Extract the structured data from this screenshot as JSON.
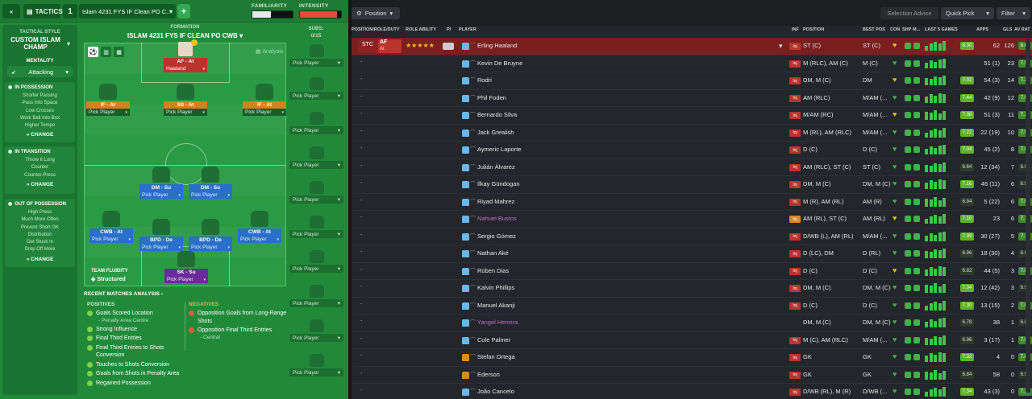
{
  "topbar": {
    "back_icon": "double-chevron-left-icon",
    "tactics_label": "TACTICS",
    "slot_number": "1",
    "tactic_name": "Islam 4231 FYS IF Clean  PO C...",
    "familiarity_label": "FAMILIARITY",
    "intensity_label": "INTENSITY",
    "familiarity_level": 0.45,
    "intensity_level": 0.9
  },
  "sidebar": {
    "style_label": "TACTICAL STYLE",
    "style_name": "CUSTOM ISLAM CHAMP",
    "mentality_label": "MENTALITY",
    "mentality_value": "Attacking",
    "in_possession": {
      "title": "IN POSSESSION",
      "lines": [
        "Shorter Passing",
        "Pass Into Space",
        "Low Crosses",
        "Work Ball Into Box",
        "Higher Tempo"
      ],
      "change": "CHANGE"
    },
    "in_transition": {
      "title": "IN TRANSITION",
      "lines": [
        "Throw It Long",
        "Counter",
        "Counter-Press"
      ],
      "change": "CHANGE"
    },
    "out_of_possession": {
      "title": "OUT OF POSSESSION",
      "lines": [
        "High Press",
        "Much More Often",
        "Prevent Short GK",
        "Distribution",
        "Get Stuck In",
        "Drop Off More"
      ],
      "change": "CHANGE"
    }
  },
  "formation": {
    "label": "FORMATION",
    "name": "ISLAM 4231 FYS IF CLEAN  PO CWB",
    "subs_label": "SUBS:",
    "subs_count": "0/15",
    "analysis_label": "Analysis",
    "fluidity_label": "TEAM FLUIDITY",
    "fluidity_value": "Structured",
    "pick": "Pick Player",
    "slots": {
      "af": {
        "role": "AF - At",
        "player": "Haaland"
      },
      "if_l": {
        "role": "IF - At"
      },
      "ss": {
        "role": "SS - At"
      },
      "if_r": {
        "role": "IF - At"
      },
      "dm_l": {
        "role": "DM - Su"
      },
      "dm_r": {
        "role": "DM - Su"
      },
      "cwb_l": {
        "role": "CWB - At"
      },
      "bpd_l": {
        "role": "BPD - De"
      },
      "bpd_r": {
        "role": "BPD - De"
      },
      "cwb_r": {
        "role": "CWB - At"
      },
      "sk": {
        "role": "SK - Su"
      }
    }
  },
  "analysis": {
    "title": "RECENT MATCHES ANALYSIS",
    "positives_label": "POSITIVES",
    "negatives_label": "NEGATIVES",
    "positives": [
      "Goals Scored Location",
      "Strong Influence",
      "Final Third Entries",
      "Final Third Entries to Shots Conversion",
      "Touches to Shots Conversion",
      "Goals from Shots in Penalty Area",
      "Regained Possession"
    ],
    "positive_sub": "- Penalty Area Centre",
    "negatives": [
      "Opposition Goals from Long-Range Shots",
      "Opposition Final Third Entries"
    ],
    "negative_sub": "- Central"
  },
  "toolbar": {
    "position_btn": "Position",
    "selection_advice": "Selection Advice",
    "quick_pick": "Quick Pick",
    "filter": "Filter"
  },
  "columns": [
    "POSITION/ROLE/DUTY",
    "ROLE ABILITY",
    "PI",
    "PLAYER",
    "INF",
    "POSITION",
    "BEST POS",
    "CON",
    "SHP",
    "M...",
    "LAST 5 GAMES",
    "APPS",
    "GLS",
    "AV RAT"
  ],
  "selected_row": {
    "slot": "STC",
    "role": "AF",
    "duty": "At",
    "stars": "★★★★★"
  },
  "players": [
    {
      "name": "Erling Haaland",
      "inf": "Inj",
      "position": "ST (C)",
      "best": "ST (C)",
      "av5": "8.30",
      "apps": "62",
      "gls": "126",
      "rat": "8.67"
    },
    {
      "name": "Kevin De Bruyne",
      "inf": "Inj",
      "position": "M (RLC), AM (C)",
      "best": "M (C)",
      "av5": "",
      "apps": "51 (1)",
      "gls": "23",
      "rat": "7.51"
    },
    {
      "name": "Rodri",
      "inf": "Inj",
      "position": "DM, M (C)",
      "best": "DM",
      "av5": "7.02",
      "apps": "54 (3)",
      "gls": "14",
      "rat": "7.25"
    },
    {
      "name": "Phil Foden",
      "inf": "Inj",
      "position": "AM (RLC)",
      "best": "M/AM (...",
      "av5": "7.44",
      "apps": "42 (9)",
      "gls": "12",
      "rat": "7.06"
    },
    {
      "name": "Bernardo Silva",
      "inf": "Inj",
      "position": "M/AM (RC)",
      "best": "M/AM (...",
      "av5": "7.08",
      "apps": "51 (3)",
      "gls": "11",
      "rat": "7.21"
    },
    {
      "name": "Jack Grealish",
      "inf": "Inj",
      "position": "M (RL), AM (RLC)",
      "best": "M/AM (...",
      "av5": "7.22",
      "apps": "22 (19)",
      "gls": "10",
      "rat": "7.06"
    },
    {
      "name": "Aymeric Laporte",
      "inf": "Inj",
      "position": "D (C)",
      "best": "D (C)",
      "av5": "7.04",
      "apps": "45 (2)",
      "gls": "8",
      "rat": "7.07"
    },
    {
      "name": "Julián Álvarez",
      "inf": "Inj",
      "position": "AM (RLC), ST (C)",
      "best": "ST (C)",
      "av5": "6.64",
      "apps": "12 (34)",
      "gls": "7",
      "rat": "6.93"
    },
    {
      "name": "İlkay Gündogan",
      "inf": "Inj",
      "position": "DM, M (C)",
      "best": "DM, M (C)",
      "av5": "7.16",
      "apps": "46 (11)",
      "gls": "6",
      "rat": "6.93"
    },
    {
      "name": "Riyad Mahrez",
      "inf": "Inj",
      "position": "M (R), AM (RL)",
      "best": "AM (R)",
      "av5": "6.94",
      "apps": "5 (22)",
      "gls": "6",
      "rat": "7.07"
    },
    {
      "name": "Nahuel Bustos",
      "inf": "Inj",
      "position": "AM (RL), ST (C)",
      "best": "AM (RL)",
      "av5": "7.10",
      "apps": "23",
      "gls": "6",
      "rat": "7.15",
      "loan": true,
      "infyel": true
    },
    {
      "name": "Sergio Gómez",
      "inf": "Inj",
      "position": "D/WB (L), AM (RL)",
      "best": "M/AM (...",
      "av5": "7.39",
      "apps": "30 (27)",
      "gls": "5",
      "rat": "7.11"
    },
    {
      "name": "Nathan Aké",
      "inf": "Inj",
      "position": "D (LC), DM",
      "best": "D (RL)",
      "av5": "6.96",
      "apps": "18 (30)",
      "gls": "4",
      "rat": "6.94"
    },
    {
      "name": "Rúben Dias",
      "inf": "Inj",
      "position": "D (C)",
      "best": "D (C)",
      "av5": "6.82",
      "apps": "44 (5)",
      "gls": "3",
      "rat": "7.02"
    },
    {
      "name": "Kalvin Phillips",
      "inf": "Inj",
      "position": "DM, M (C)",
      "best": "DM, M (C)",
      "av5": "7.04",
      "apps": "12 (42)",
      "gls": "3",
      "rat": "6.95"
    },
    {
      "name": "Manuel Akanji",
      "inf": "Inj",
      "position": "D (C)",
      "best": "D (C)",
      "av5": "7.30",
      "apps": "13 (15)",
      "gls": "2",
      "rat": "7.07"
    },
    {
      "name": "Yangel Herrera",
      "inf": "",
      "position": "DM, M (C)",
      "best": "DM, M (C)",
      "av5": "6.78",
      "apps": "38",
      "gls": "1",
      "rat": "6.86",
      "loan": true
    },
    {
      "name": "Cole Palmer",
      "inf": "Inj",
      "position": "M (C), AM (RLC)",
      "best": "M/AM (...",
      "av5": "6.96",
      "apps": "3 (17)",
      "gls": "1",
      "rat": "7.03"
    },
    {
      "name": "Stefan Ortega",
      "inf": "Inj",
      "position": "GK",
      "best": "GK",
      "av5": "7.32",
      "apps": "4",
      "gls": "0",
      "rat": "7.00",
      "gk": true
    },
    {
      "name": "Ederson",
      "inf": "Inj",
      "position": "GK",
      "best": "GK",
      "av5": "6.84",
      "apps": "58",
      "gls": "0",
      "rat": "6.93",
      "gk": true
    },
    {
      "name": "João Cancelo",
      "inf": "Inj",
      "position": "D/WB (RL), M (R)",
      "best": "D/WB (...",
      "av5": "7.34",
      "apps": "43 (3)",
      "gls": "0",
      "rat": "7.21"
    }
  ],
  "colors": {
    "accent_green": "#218a3a",
    "selected_row": "#7a1f1f",
    "good_rating": "#5fb12e",
    "injury_badge": "#b8352e"
  }
}
